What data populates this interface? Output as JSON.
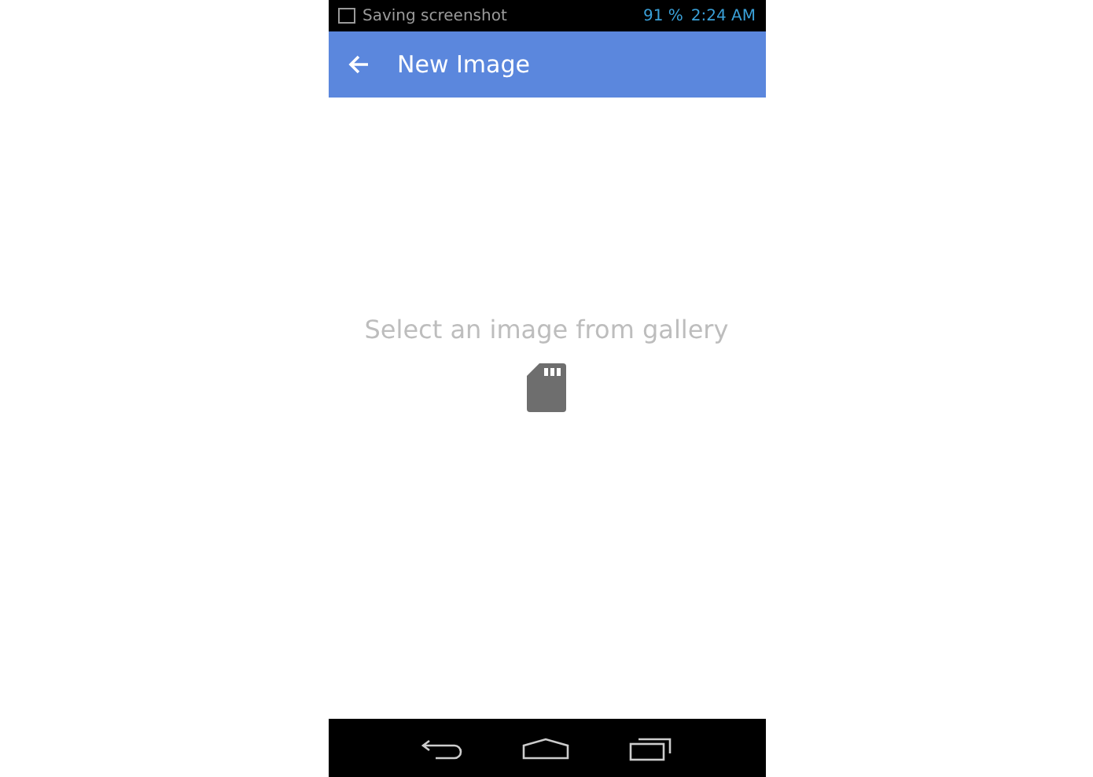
{
  "status_bar": {
    "notification": "Saving screenshot",
    "battery": "91 %",
    "time": "2:24 AM"
  },
  "app_bar": {
    "title": "New Image"
  },
  "empty_state": {
    "message": "Select an image from gallery"
  }
}
